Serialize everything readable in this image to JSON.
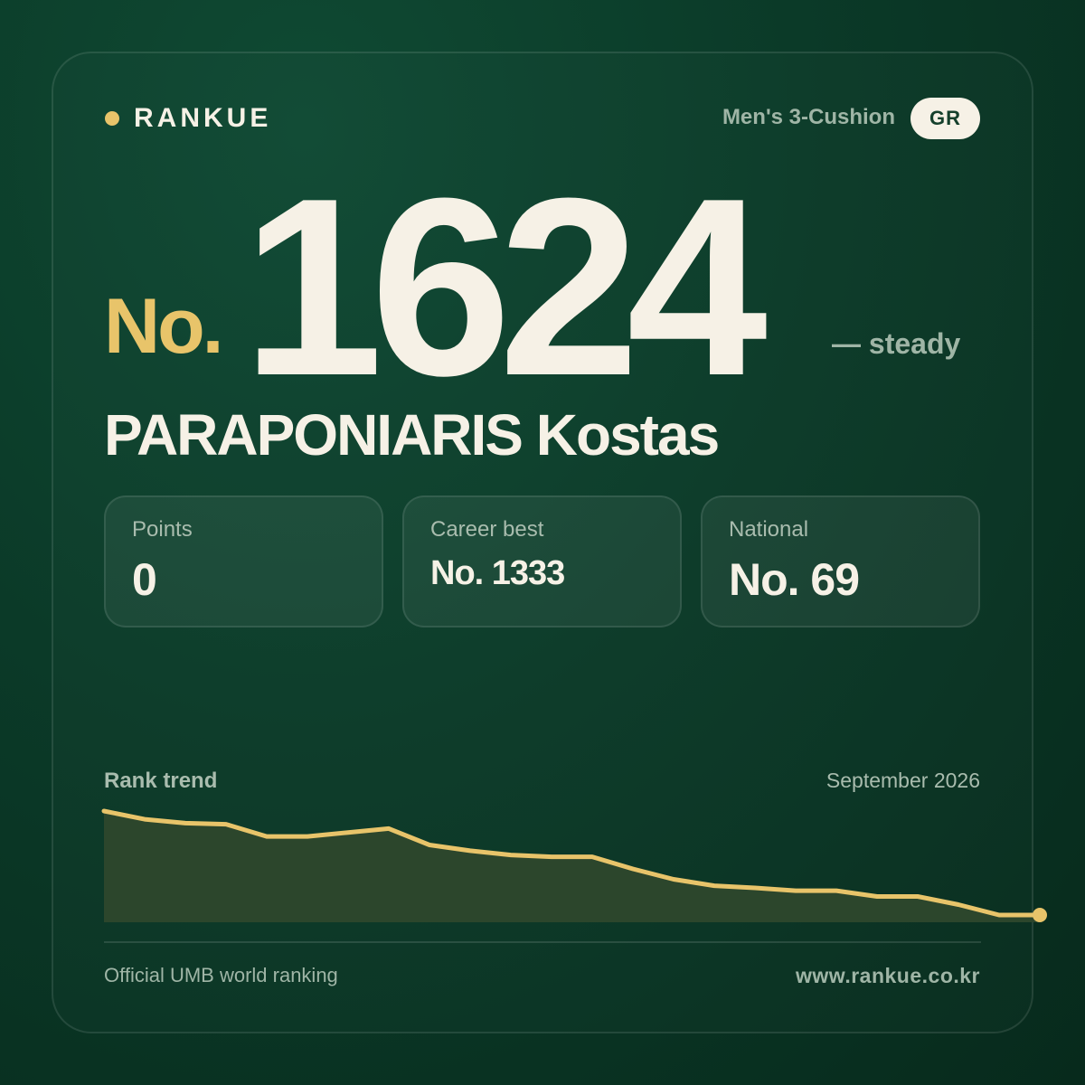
{
  "brand": {
    "name": "RANKUE"
  },
  "header": {
    "category": "Men's 3-Cushion",
    "country_code": "GR"
  },
  "rank": {
    "prefix": "No.",
    "current": "1624",
    "change": "— steady"
  },
  "player": {
    "name": "PARAPONIARIS Kostas"
  },
  "stats": [
    {
      "label": "Points",
      "value": "0"
    },
    {
      "label": "Career best",
      "value": "No. 1333"
    },
    {
      "label": "National",
      "value": "No. 69"
    }
  ],
  "trend": {
    "label": "Rank trend",
    "date": "September 2026"
  },
  "chart_data": {
    "type": "area",
    "title": "Rank trend",
    "xlabel": "",
    "ylabel": "",
    "y_inverted": true,
    "grid": false,
    "legend": "none",
    "values": [
      1333,
      1356,
      1367,
      1370,
      1404,
      1404,
      1393,
      1382,
      1428,
      1444,
      1456,
      1461,
      1461,
      1495,
      1524,
      1542,
      1548,
      1556,
      1556,
      1572,
      1572,
      1595,
      1624,
      1624
    ],
    "line_color": "#e8c46a",
    "fill_color": "#2c462c"
  },
  "footer": {
    "source": "Official UMB world ranking",
    "url": "www.rankue.co.kr"
  }
}
